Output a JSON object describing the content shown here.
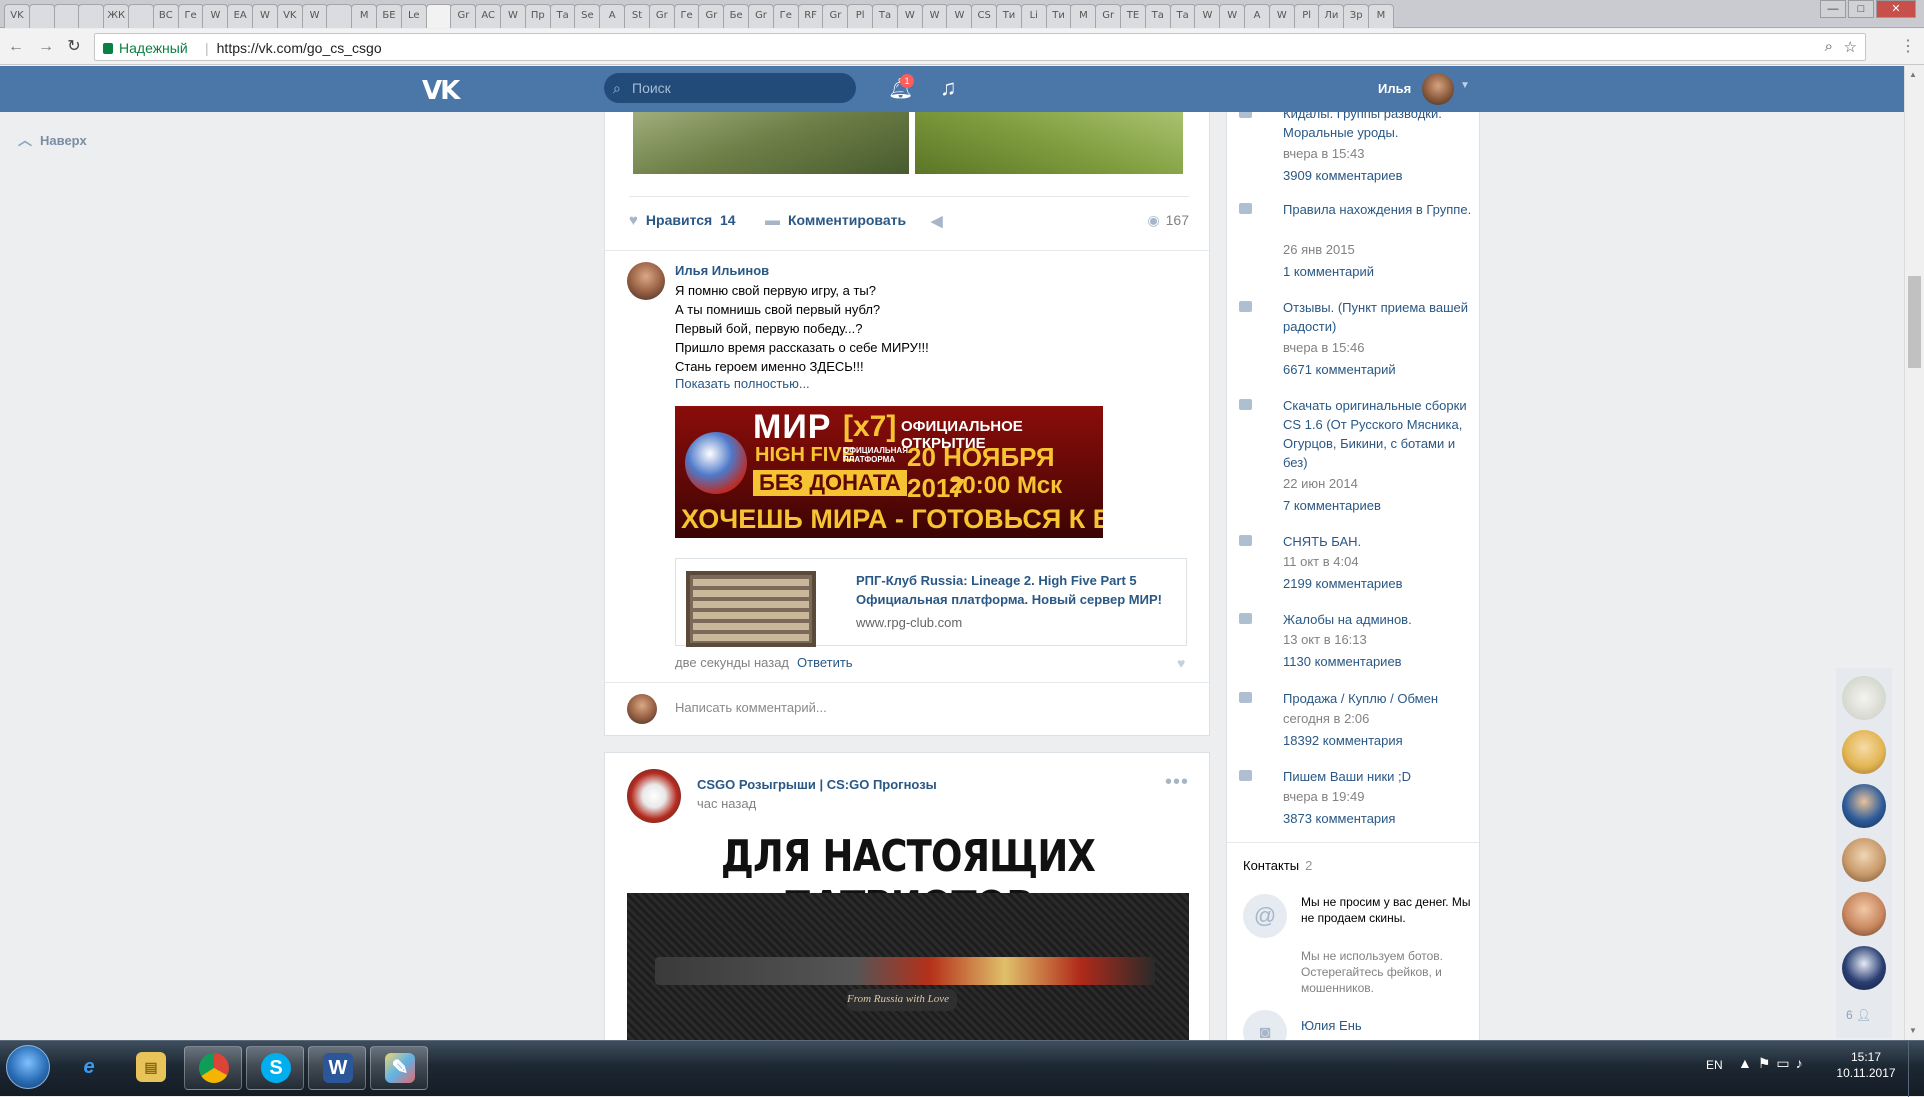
{
  "browser": {
    "tabs": [
      "VK",
      "",
      "",
      "",
      "ЖК",
      "",
      "ВС",
      "Ге",
      "W",
      "EA",
      "W",
      "VK",
      "W",
      "",
      "M",
      "БЕ",
      "Le",
      "",
      "Gr",
      "AC",
      "W",
      "Пр",
      "Та",
      "Se",
      "A",
      "St",
      "Gr",
      "Ге",
      "Gr",
      "Бе",
      "Gr",
      "Ге",
      "RF",
      "Gr",
      "Pl",
      "Та",
      "W",
      "W",
      "W",
      "CS",
      "Ти",
      "Li",
      "Ти",
      "M",
      "Gr",
      "TE",
      "Та",
      "Та",
      "W",
      "W",
      "A",
      "W",
      "Pl",
      "Ли",
      "Зр",
      "M"
    ],
    "active_tab_index": 17,
    "window_buttons": {
      "minimize": "—",
      "maximize": "□",
      "close": "✕"
    },
    "secure_label": "Надежный",
    "url": "https://vk.com/go_cs_csgo",
    "nav": {
      "back": "←",
      "forward": "→",
      "reload": "↻",
      "zoom": "⌕",
      "star": "☆",
      "menu": "⋮"
    }
  },
  "vk_header": {
    "logo": "VK",
    "search_placeholder": "Поиск",
    "notifications_count": "1",
    "user_name": "Илья"
  },
  "left_nav": {
    "up_label": "Наверх"
  },
  "post1": {
    "likes_label": "Нравится",
    "likes_count": "14",
    "comment_label": "Комментировать",
    "views_count": "167"
  },
  "comment": {
    "author": "Илья Ильинов",
    "lines": [
      "Я помню свой первую игру, а ты?",
      "А ты помнишь свой первый нубл?",
      "Первый бой, первую победу...?",
      "Пришло время рассказать о себе МИРУ!!!",
      "Стань героем именно ЗДЕСЬ!!!"
    ],
    "show_more": "Показать полностью...",
    "banner": {
      "mir": "МИР",
      "x7": "[x7]",
      "official": "ОФИЦИАЛЬНОЕ ОТКРЫТИЕ",
      "high_five": "HIGH FIVE",
      "platform": "ОФИЦИАЛЬНАЯ ПЛАТФОРМА",
      "date": "20 НОЯБРЯ 2017",
      "no_donate": "БЕЗ ДОНАТА",
      "time": "20:00 Мск",
      "slogan": "ХОЧЕШЬ МИРА - ГОТОВЬСЯ К ВОЙНЕ"
    },
    "link_title": "РПГ-Клуб Russia: Lineage 2. High Five Part 5 Официальная платформа. Новый сервер МИР!",
    "link_url": "www.rpg-club.com",
    "time": "две секунды назад",
    "reply_label": "Ответить",
    "write_placeholder": "Написать комментарий..."
  },
  "post2": {
    "group_name": "CSGO Розыгрыши | CS:GO Прогнозы",
    "time": "час назад",
    "more": "•••",
    "poster_title": "ДЛЯ НАСТОЯЩИХ ПАТРИОТОВ",
    "poster_caption": "From Russia with Love"
  },
  "discussions": [
    {
      "title": "Кидалы. Группы разводки. Моральные уроды.",
      "date": "вчера в 15:43",
      "count": "3909 комментариев"
    },
    {
      "title": "Правила нахождения в Группе.",
      "date": "26 янв 2015",
      "count": "1 комментарий"
    },
    {
      "title": "Отзывы. (Пункт приема вашей радости)",
      "date": "вчера в 15:46",
      "count": "6671 комментарий"
    },
    {
      "title": "Скачать оригинальные сборки CS 1.6 (От Русского Мясника, Огурцов, Бикини, с ботами и без)",
      "date": "22 июн 2014",
      "count": "7 комментариев"
    },
    {
      "title": "СНЯТЬ БАН.",
      "date": "11 окт в 4:04",
      "count": "2199 комментариев"
    },
    {
      "title": "Жалобы на админов.",
      "date": "13 окт в 16:13",
      "count": "1130 комментариев"
    },
    {
      "title": "Продажа / Куплю / Обмен",
      "date": "сегодня в 2:06",
      "count": "18392 комментария"
    },
    {
      "title": "Пишем Ваши ники ;D",
      "date": "вчера в 19:49",
      "count": "3873 комментария"
    }
  ],
  "contacts": {
    "heading": "Контакты",
    "count": "2",
    "c1_text": "Мы не просим у вас денег. Мы не продаем скины.",
    "c1_desc": "Мы не используем ботов. Остерегайтесь фейков, и мошенников.",
    "c2_name": "Юлия Ень"
  },
  "chat": {
    "online_count": "6"
  },
  "taskbar": {
    "apps": [
      "internet-explorer",
      "file-explorer",
      "chrome",
      "skype",
      "word",
      "paint"
    ],
    "lang": "EN",
    "time": "15:17",
    "date": "10.11.2017"
  },
  "colors": {
    "vk_blue": "#4a76a8",
    "link": "#2a5885",
    "meta": "#828282",
    "bg": "#edeef0"
  }
}
